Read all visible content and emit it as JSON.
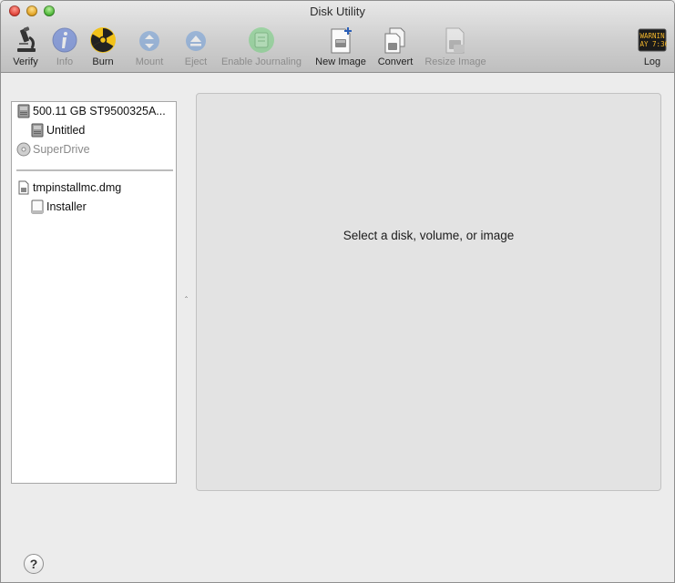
{
  "window": {
    "title": "Disk Utility"
  },
  "toolbar": {
    "verify": "Verify",
    "info": "Info",
    "burn": "Burn",
    "mount": "Mount",
    "eject": "Eject",
    "enable_journaling": "Enable Journaling",
    "new_image": "New Image",
    "convert": "Convert",
    "resize_image": "Resize Image",
    "log": "Log",
    "log_icon_text": [
      "WARNIN",
      "AY 7:36"
    ]
  },
  "sidebar": {
    "items": [
      {
        "label": "500.11 GB ST9500325A...",
        "icon": "hard-drive-icon"
      },
      {
        "label": "Untitled",
        "icon": "volume-icon"
      },
      {
        "label": "SuperDrive",
        "icon": "optical-drive-icon"
      },
      {
        "label": "tmpinstallmc.dmg",
        "icon": "disk-image-icon"
      },
      {
        "label": "Installer",
        "icon": "mounted-volume-icon"
      }
    ]
  },
  "main": {
    "message": "Select a disk, volume, or image"
  },
  "help": {
    "label": "?"
  },
  "colors": {
    "toolbar_top": "#e8e8e8",
    "toolbar_bottom": "#bfbfbf",
    "panel": "#e3e3e3"
  }
}
